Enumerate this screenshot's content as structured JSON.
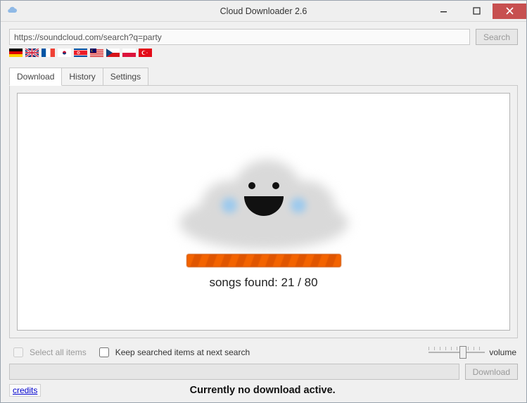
{
  "window": {
    "title": "Cloud Downloader 2.6"
  },
  "search": {
    "url": "https://soundcloud.com/search?q=party",
    "button": "Search"
  },
  "flags": [
    "de",
    "gb",
    "fr",
    "kr",
    "kp",
    "my",
    "cz",
    "pl",
    "tr"
  ],
  "tabs": {
    "download": "Download",
    "history": "History",
    "settings": "Settings"
  },
  "main": {
    "songs_label": "songs found: 21 / 80"
  },
  "options": {
    "select_all": "Select all items",
    "keep_searched": "Keep searched items at next search",
    "volume_label": "volume"
  },
  "download": {
    "button": "Download"
  },
  "footer": {
    "credits": "credits",
    "status": "Currently no download active."
  }
}
